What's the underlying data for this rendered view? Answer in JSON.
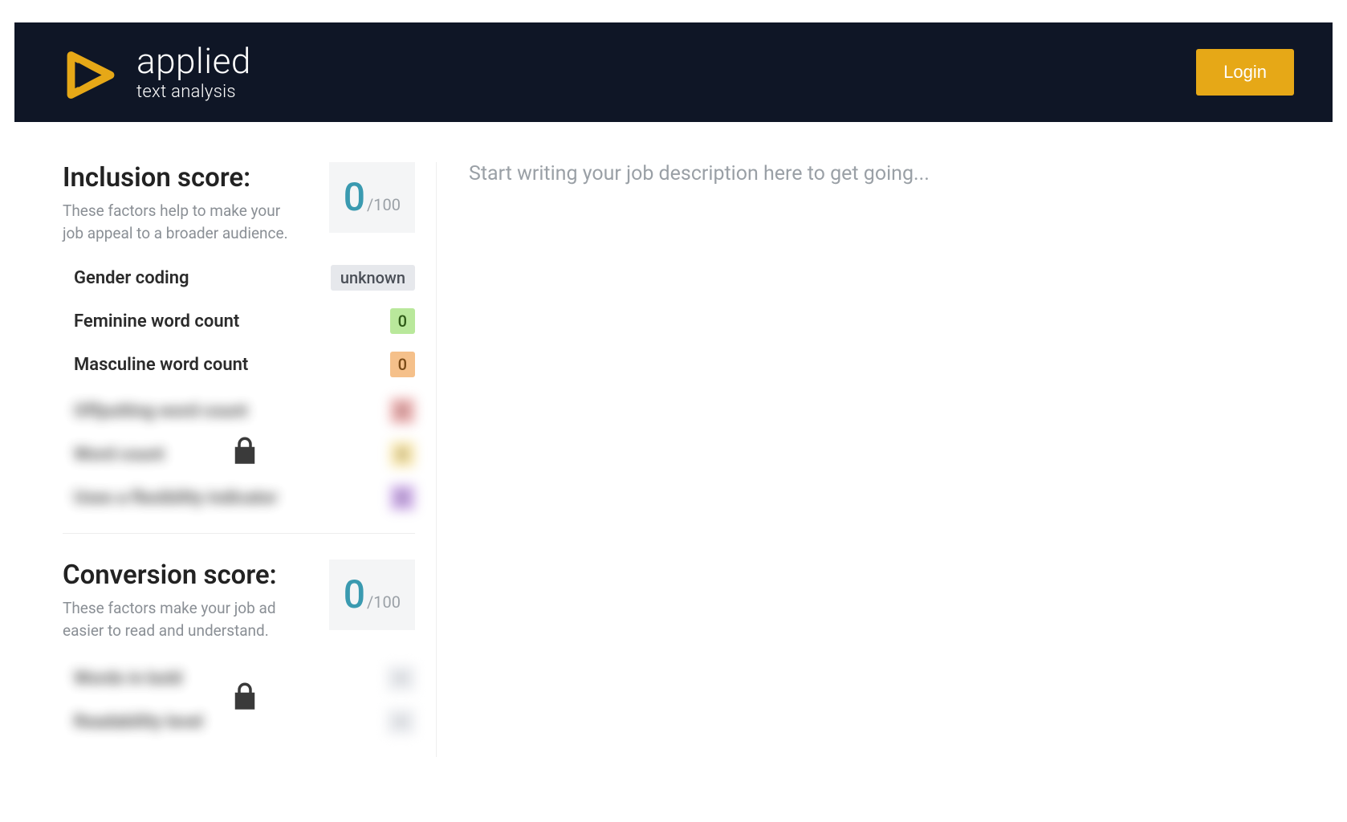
{
  "header": {
    "brand": "applied",
    "subtitle": "text analysis",
    "login_label": "Login"
  },
  "main": {
    "placeholder": "Start writing your job description here to get going..."
  },
  "inclusion": {
    "title": "Inclusion score:",
    "desc": "These factors help to make your job appeal to a broader audience.",
    "value": "0",
    "max": "/100",
    "metrics": {
      "gender_coding_label": "Gender coding",
      "gender_coding_value": "unknown",
      "feminine_label": "Feminine word count",
      "feminine_value": "0",
      "masculine_label": "Masculine word count",
      "masculine_value": "0",
      "locked": [
        {
          "label": "Offputting word count",
          "value": "0"
        },
        {
          "label": "Word count",
          "value": "0"
        },
        {
          "label": "Uses a flexibility indicator",
          "value": "0"
        }
      ]
    }
  },
  "conversion": {
    "title": "Conversion score:",
    "desc": "These factors make your job ad easier to read and understand.",
    "value": "0",
    "max": "/100",
    "locked": [
      {
        "label": "Words in bold",
        "value": "—"
      },
      {
        "label": "Readability level",
        "value": "—"
      }
    ]
  },
  "colors": {
    "accent": "#e6a817",
    "teal": "#3a9ab0",
    "header_bg": "#0f1626"
  }
}
